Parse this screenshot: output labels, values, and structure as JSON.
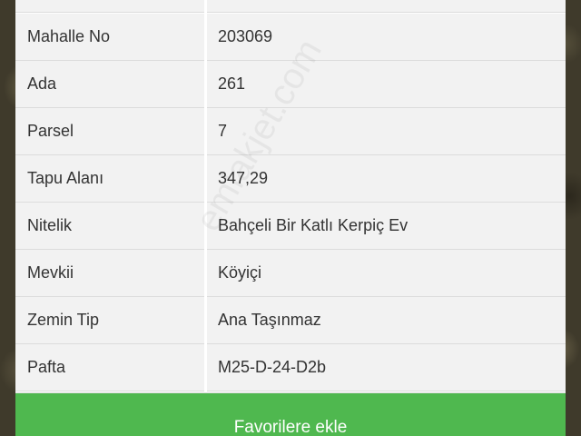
{
  "rows": [
    {
      "label": "",
      "value": ""
    },
    {
      "label": "Mahalle No",
      "value": "203069"
    },
    {
      "label": "Ada",
      "value": "261"
    },
    {
      "label": "Parsel",
      "value": "7"
    },
    {
      "label": "Tapu Alanı",
      "value": "347,29"
    },
    {
      "label": "Nitelik",
      "value": "Bahçeli Bir Katlı Kerpiç Ev"
    },
    {
      "label": "Mevkii",
      "value": "Köyiçi"
    },
    {
      "label": "Zemin Tip",
      "value": "Ana Taşınmaz"
    },
    {
      "label": "Pafta",
      "value": "M25-D-24-D2b"
    }
  ],
  "watermark": "emlakjet.com",
  "favorite_button": {
    "label": "Favorilere ekle"
  },
  "colors": {
    "button": "#4fb84f",
    "row_bg": "#f2f2f2",
    "text": "#333333"
  }
}
